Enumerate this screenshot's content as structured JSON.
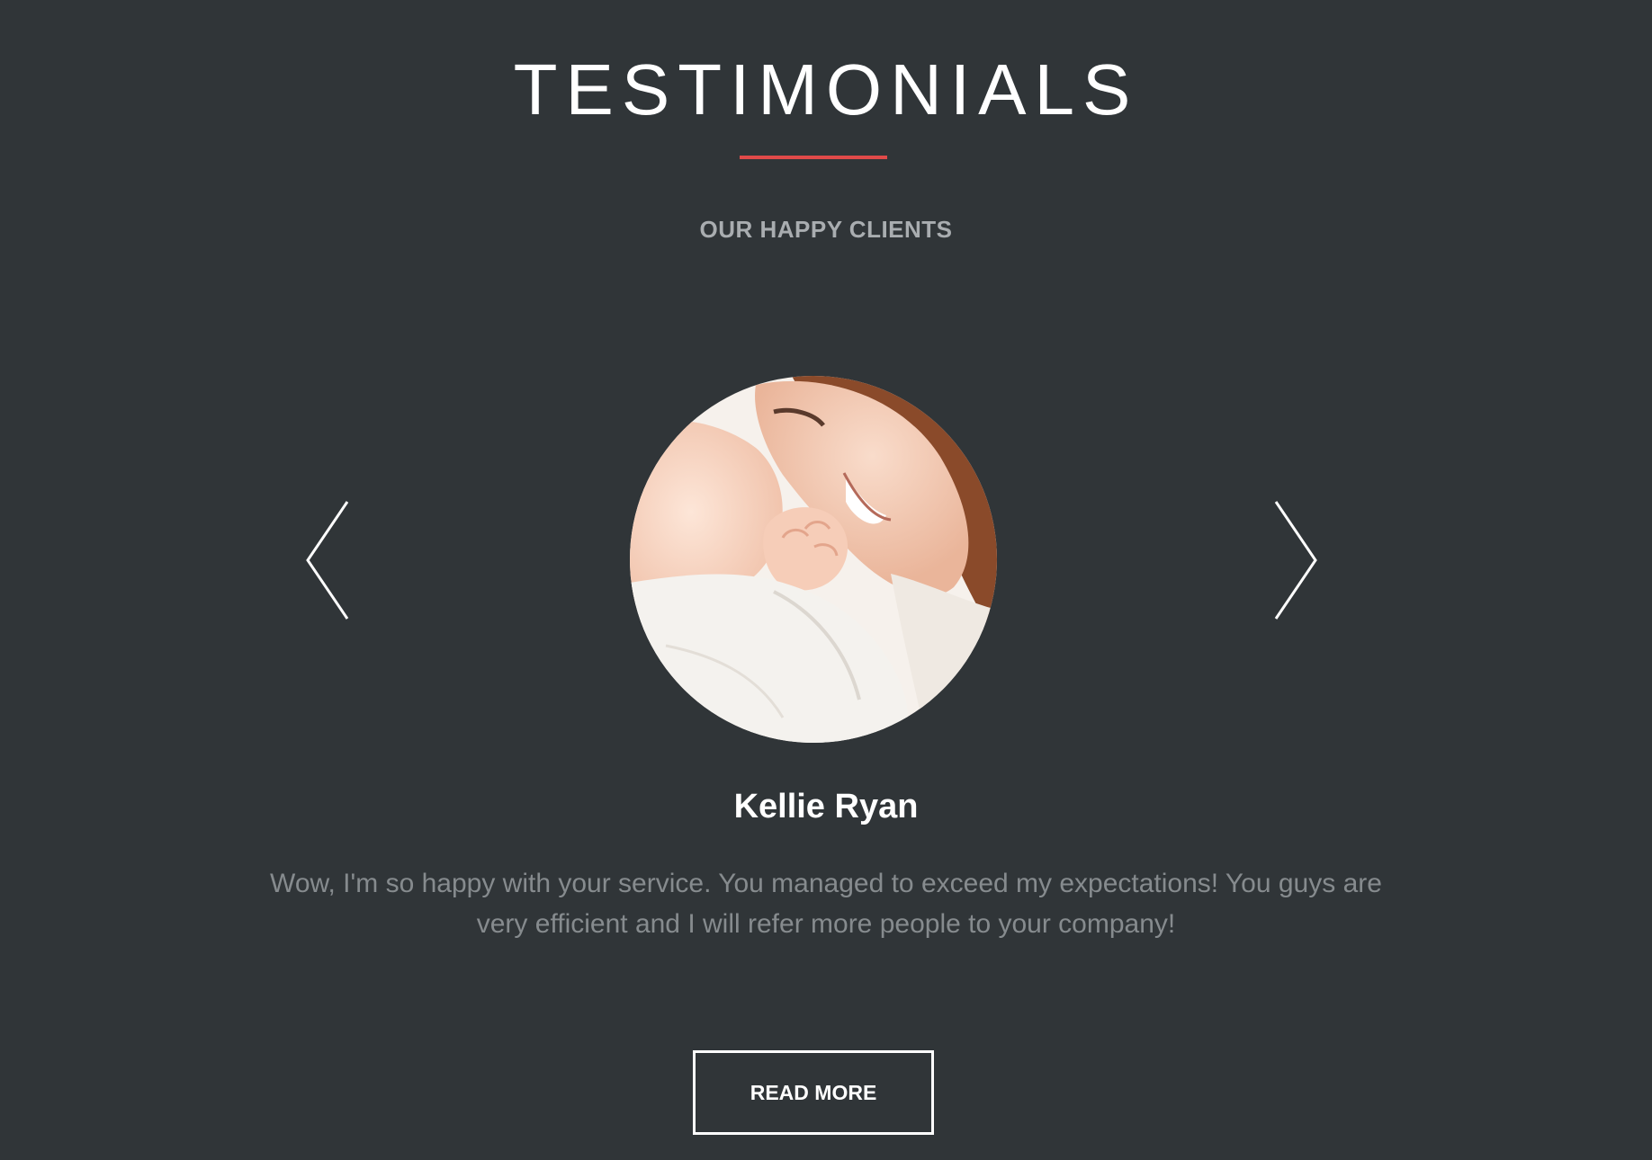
{
  "section": {
    "title": "TESTIMONIALS",
    "subtitle": "OUR HAPPY CLIENTS",
    "accent_color": "#e04a49",
    "background_color": "#303538"
  },
  "carousel": {
    "prev_icon": "chevron-left-icon",
    "next_icon": "chevron-right-icon"
  },
  "testimonial": {
    "photo_icon": "client-photo",
    "name": "Kellie Ryan",
    "quote": "Wow, I'm so happy with your service. You managed to exceed my expectations! You guys are very efficient and I will refer more people to your company!"
  },
  "cta": {
    "label": "READ MORE"
  }
}
